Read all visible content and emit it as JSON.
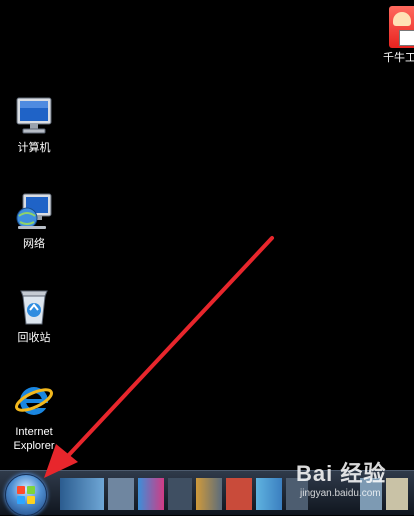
{
  "desktop": {
    "icons": [
      {
        "label": "计算机",
        "icon": "computer-icon"
      },
      {
        "label": "网络",
        "icon": "network-icon"
      },
      {
        "label": "回收站",
        "icon": "recycle-bin-icon"
      },
      {
        "label": "Internet\nExplorer",
        "icon": "internet-explorer-icon"
      }
    ],
    "app_shortcut": {
      "label": "千牛工",
      "icon": "qianniu-app-icon"
    }
  },
  "taskbar": {
    "start_button": {
      "icon": "windows-start-orb-icon"
    }
  },
  "watermark": {
    "text": "Bai 经验",
    "sub": "jingyan.baidu.com"
  },
  "colors": {
    "annotation_arrow": "#e8262c",
    "taskbar": "#1a222e"
  }
}
